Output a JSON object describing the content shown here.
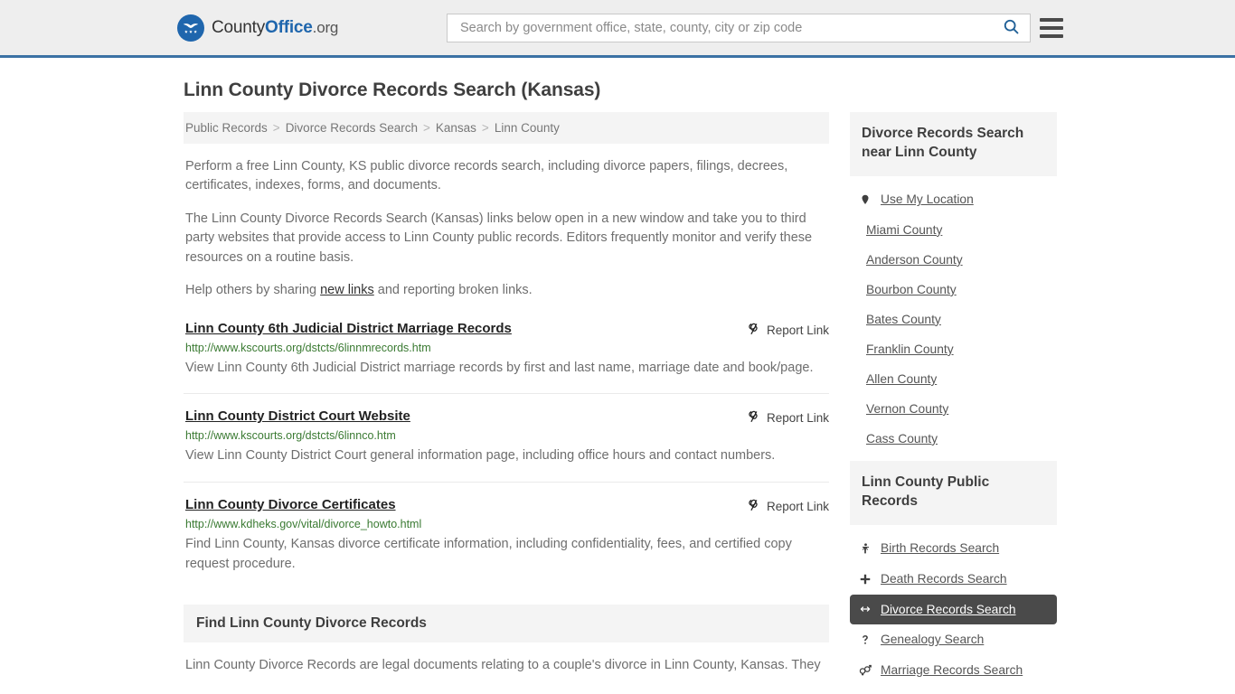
{
  "header": {
    "brand": {
      "pre": "County",
      "mid": "Office",
      "tld": ".org",
      "icon": "eagle-shield-logo"
    },
    "search": {
      "placeholder": "Search by government office, state, county, city or zip code",
      "value": ""
    },
    "search_icon": "search-icon",
    "menu_icon": "hamburger-menu-icon",
    "accent_color": "#3b72a4",
    "background_color": "#eeeeee"
  },
  "page": {
    "title": "Linn County Divorce Records Search (Kansas)"
  },
  "breadcrumb": {
    "items": [
      "Public Records",
      "Divorce Records Search",
      "Kansas",
      "Linn County"
    ],
    "separator": ">"
  },
  "intro": {
    "p1": "Perform a free Linn County, KS public divorce records search, including divorce papers, filings, decrees, certificates, indexes, forms, and documents.",
    "p2": "The Linn County Divorce Records Search (Kansas) links below open in a new window and take you to third party websites that provide access to Linn County public records. Editors frequently monitor and verify these resources on a routine basis.",
    "p3_before": "Help others by sharing ",
    "p3_link": "new links",
    "p3_after": " and reporting broken links."
  },
  "results": {
    "report_label": "Report Link",
    "report_icon": "broken-link-icon",
    "items": [
      {
        "title": "Linn County 6th Judicial District Marriage Records",
        "url": "http://www.kscourts.org/dstcts/6linnmrecords.htm",
        "desc": "View Linn County 6th Judicial District marriage records by first and last name, marriage date and book/page."
      },
      {
        "title": "Linn County District Court Website",
        "url": "http://www.kscourts.org/dstcts/6linnco.htm",
        "desc": "View Linn County District Court general information page, including office hours and contact numbers."
      },
      {
        "title": "Linn County Divorce Certificates",
        "url": "http://www.kdheks.gov/vital/divorce_howto.html",
        "desc": "Find Linn County, Kansas divorce certificate information, including confidentiality, fees, and certified copy request procedure."
      }
    ]
  },
  "find_section": {
    "heading": "Find Linn County Divorce Records",
    "body": "Linn County Divorce Records are legal documents relating to a couple's divorce in Linn County, Kansas. They"
  },
  "sidebar": {
    "nearby": {
      "heading": "Divorce Records Search near Linn County",
      "items": [
        {
          "label": "Use My Location",
          "icon": "map-pin-icon",
          "active": false
        },
        {
          "label": "Miami County",
          "icon": "",
          "active": false
        },
        {
          "label": "Anderson County",
          "icon": "",
          "active": false
        },
        {
          "label": "Bourbon County",
          "icon": "",
          "active": false
        },
        {
          "label": "Bates County",
          "icon": "",
          "active": false
        },
        {
          "label": "Franklin County",
          "icon": "",
          "active": false
        },
        {
          "label": "Allen County",
          "icon": "",
          "active": false
        },
        {
          "label": "Vernon County",
          "icon": "",
          "active": false
        },
        {
          "label": "Cass County",
          "icon": "",
          "active": false
        }
      ]
    },
    "public_records": {
      "heading": "Linn County Public Records",
      "items": [
        {
          "label": "Birth Records Search",
          "icon": "baby-icon",
          "active": false
        },
        {
          "label": "Death Records Search",
          "icon": "cross-icon",
          "active": false
        },
        {
          "label": "Divorce Records Search",
          "icon": "left-right-arrow-icon",
          "active": true
        },
        {
          "label": "Genealogy Search",
          "icon": "question-mark-icon",
          "active": false
        },
        {
          "label": "Marriage Records Search",
          "icon": "gender-symbols-icon",
          "active": false
        }
      ]
    },
    "active_background": "#4a4a4a"
  }
}
